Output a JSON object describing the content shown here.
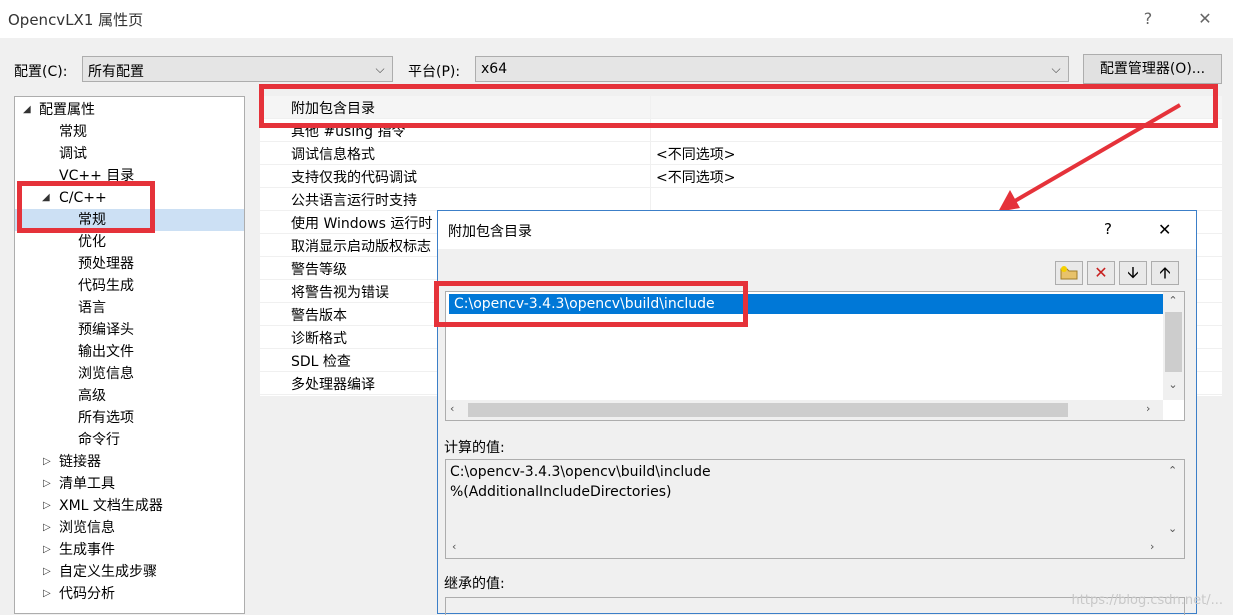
{
  "window": {
    "title": "OpencvLX1 属性页",
    "help_label": "?",
    "close_label": "✕"
  },
  "config": {
    "config_label": "配置(C):",
    "config_value": "所有配置",
    "platform_label": "平台(P):",
    "platform_value": "x64",
    "manager_button": "配置管理器(O)..."
  },
  "tree": {
    "root": "配置属性",
    "items": [
      "常规",
      "调试",
      "VC++ 目录"
    ],
    "cpp": "C/C++",
    "cpp_items": [
      "常规",
      "优化",
      "预处理器",
      "代码生成",
      "语言",
      "预编译头",
      "输出文件",
      "浏览信息",
      "高级",
      "所有选项",
      "命令行"
    ],
    "collapsed": [
      "链接器",
      "清单工具",
      "XML 文档生成器",
      "浏览信息",
      "生成事件",
      "自定义生成步骤",
      "代码分析"
    ]
  },
  "grid": {
    "rows": [
      {
        "key": "附加包含目录",
        "value": ""
      },
      {
        "key": "其他 #using 指令",
        "value": ""
      },
      {
        "key": "调试信息格式",
        "value": "<不同选项>"
      },
      {
        "key": "支持仅我的代码调试",
        "value": "<不同选项>"
      },
      {
        "key": "公共语言运行时支持",
        "value": ""
      },
      {
        "key": "使用 Windows 运行时",
        "value": ""
      },
      {
        "key": "取消显示启动版权标志",
        "value": ""
      },
      {
        "key": "警告等级",
        "value": ""
      },
      {
        "key": "将警告视为错误",
        "value": ""
      },
      {
        "key": "警告版本",
        "value": ""
      },
      {
        "key": "诊断格式",
        "value": ""
      },
      {
        "key": "SDL 检查",
        "value": ""
      },
      {
        "key": "多处理器编译",
        "value": ""
      }
    ]
  },
  "dialog": {
    "title": "附加包含目录",
    "help_label": "?",
    "close_label": "✕",
    "tools": [
      "new-folder-icon",
      "delete-icon",
      "move-down-icon",
      "move-up-icon"
    ],
    "list_items": [
      "C:\\opencv-3.4.3\\opencv\\build\\include"
    ],
    "computed_label": "计算的值:",
    "computed_lines": [
      "C:\\opencv-3.4.3\\opencv\\build\\include",
      "%(AdditionalIncludeDirectories)"
    ],
    "inherited_label": "继承的值:"
  },
  "watermark": "https://blog.csdn.net/...",
  "colors": {
    "highlight": "#e5323a",
    "selection": "#0078d7",
    "tree_selection": "#cce0f4"
  }
}
